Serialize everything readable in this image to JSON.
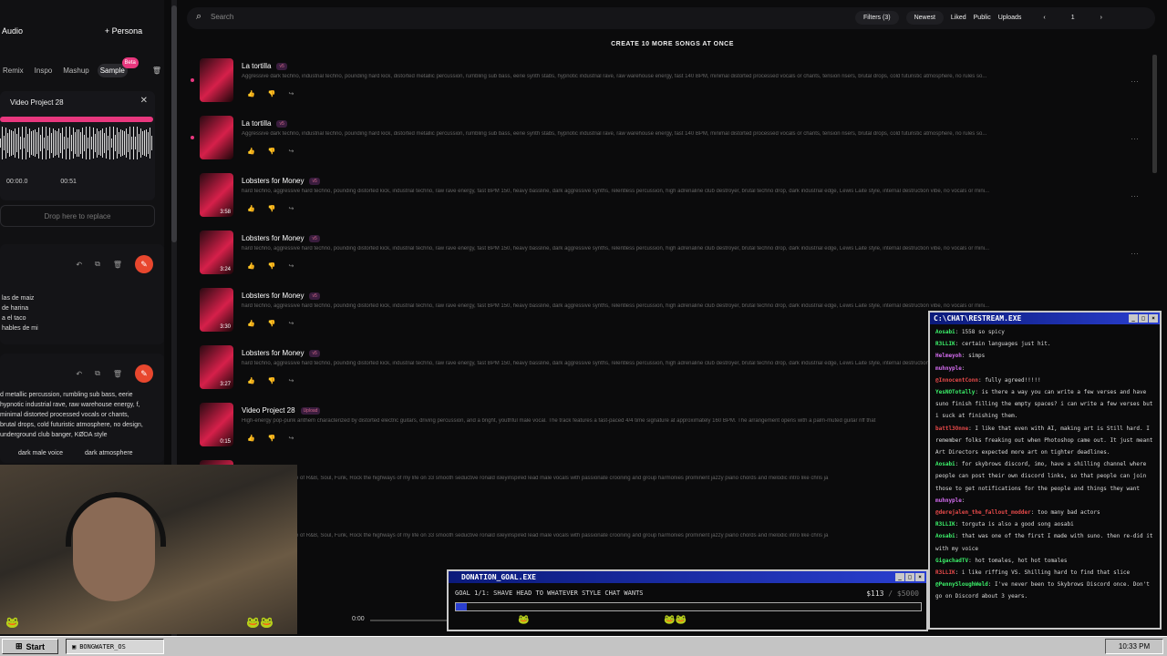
{
  "left": {
    "tab_audio": "Audio",
    "tab_persona": "+ Persona",
    "modes": [
      "Remix",
      "Inspo",
      "Mashup",
      "Sample"
    ],
    "beta": "Beta",
    "project_title": "Video Project 28",
    "time_start": "00:00.0",
    "time_end": "00:51",
    "drop": "Drop here to replace",
    "lyrics": [
      "las de maiz",
      "de harina",
      "a el taco",
      "hables de mi"
    ],
    "style_text": "d metallic percussion, rumbling sub bass, eerie hypnotic industrial rave, raw warehouse energy, f, minimal distorted processed vocals or chants, brutal drops, cold futuristic atmosphere, no design, underground club banger, KØDA style",
    "tags": [
      "dark male voice",
      "dark atmosphere"
    ]
  },
  "top": {
    "search_placeholder": "Search",
    "filters": "Filters (3)",
    "sort": "Newest",
    "liked": "Liked",
    "public": "Public",
    "uploads": "Uploads",
    "page": "1"
  },
  "create": "CREATE 10 MORE SONGS AT ONCE",
  "songs": [
    {
      "title": "La tortilla",
      "badge": "v5",
      "dur": "",
      "desc": "Aggressive dark techno, industrial techno, pounding hard kick, distorted metallic percussion, rumbling sub bass, eerie synth stabs, hypnotic industrial rave, raw warehouse energy, fast 140 BPM, minimal distorted processed vocals or chants, tension risers, brutal drops, cold futuristic atmosphere, no rules so..."
    },
    {
      "title": "La tortilla",
      "badge": "v5",
      "dur": "",
      "desc": "Aggressive dark techno, industrial techno, pounding hard kick, distorted metallic percussion, rumbling sub bass, eerie synth stabs, hypnotic industrial rave, raw warehouse energy, fast 140 BPM, minimal distorted processed vocals or chants, tension risers, brutal drops, cold futuristic atmosphere, no rules so..."
    },
    {
      "title": "Lobsters for Money",
      "badge": "v5",
      "dur": "3:58",
      "desc": "hard techno, aggressive hard techno, pounding distorted kick, industrial techno, raw rave energy, fast BPM 150, heavy bassline, dark aggressive synths, relentless percussion, high adrenaline club destroyer, brutal techno drop, dark industrial edge, Lewis Laite style, internal destruction vibe, no vocals or mini..."
    },
    {
      "title": "Lobsters for Money",
      "badge": "v5",
      "dur": "3:24",
      "desc": "hard techno, aggressive hard techno, pounding distorted kick, industrial techno, raw rave energy, fast BPM 150, heavy bassline, dark aggressive synths, relentless percussion, high adrenaline club destroyer, brutal techno drop, dark industrial edge, Lewis Laite style, internal destruction vibe, no vocals or mini..."
    },
    {
      "title": "Lobsters for Money",
      "badge": "v5",
      "dur": "3:30",
      "desc": "hard techno, aggressive hard techno, pounding distorted kick, industrial techno, raw rave energy, fast BPM 150, heavy bassline, dark aggressive synths, relentless percussion, high adrenaline club destroyer, brutal techno drop, dark industrial edge, Lewis Laite style, internal destruction vibe, no vocals or mini..."
    },
    {
      "title": "Lobsters for Money",
      "badge": "v5",
      "dur": "3:27",
      "desc": "hard techno, aggressive hard techno, pounding distorted kick, industrial techno, raw rave energy, fast BPM 150, heavy bassline, dark aggressive synths, relentless percussion, high adrenaline club destroyer, brutal techno drop, dark industrial edge, Lewis Laite style, internal destruction vibe, no vocals or mini..."
    },
    {
      "title": "Video Project 28",
      "badge": "Upload",
      "dur": "0:15",
      "desc": "High-energy pop-punk anthem characterized by distorted electric guitars, driving percussion, and a bright, youthful male vocal. The track features a fast-paced 4/4 time signature at approximately 160 BPM. The arrangement opens with a palm-muted guitar riff that"
    },
    {
      "title": "",
      "badge": "v5",
      "dur": "",
      "desc": "ballad in the exact style of R&B, Soul, Funk, Rock the highways of my life on 33 smooth seductive ronald isleyinspired lead male vocals with passionate crooning and group harmonies prominent jazzy piano chords and melodic intro like chris ja"
    },
    {
      "title": "",
      "badge": "v5",
      "dur": "",
      "desc": "ballad in the exact style of R&B, Soul, Funk, Rock the highways of my life on 33 smooth seductive ronald isleyinspired lead male vocals with passionate crooning and group harmonies prominent jazzy piano chords and melodic intro like chris ja"
    }
  ],
  "chat": {
    "title": "C:\\CHAT\\RESTREAM.EXE",
    "messages": [
      {
        "user": "Aosabi",
        "color": "#3cf06a",
        "text": "1558 so spicy"
      },
      {
        "user": "R3LLIK",
        "color": "#3cf06a",
        "text": "certain languages just hit."
      },
      {
        "user": "Helmeyoh",
        "color": "#d46cf0",
        "text": "simps"
      },
      {
        "user": "muhnyple",
        "color": "#d46cf0",
        "text": ""
      },
      {
        "user": "@InnocentConn",
        "color": "#e84a4a",
        "text": "fully agreed!!!!!"
      },
      {
        "user": "YesNOTotally",
        "color": "#3cf06a",
        "text": "is there a way you can write a few verses and have suno finish filling the empty spaces? i can write a few verses but i suck at finishing them."
      },
      {
        "user": "battl3Onne",
        "color": "#e84a4a",
        "text": "I like that even with AI, making art is Still hard. I remember folks freaking out when Photoshop came out. It just meant Art Directors expected more art on tighter deadlines."
      },
      {
        "user": "Aosabi",
        "color": "#3cf06a",
        "text": "for skybrows discord, imo, have a shilling channel where people can post their own discord links, so that people can join those to get notifications for the people and things they want"
      },
      {
        "user": "muhnyple",
        "color": "#d46cf0",
        "text": ""
      },
      {
        "user": "@derejalen_the_fallout_modder",
        "color": "#e84a4a",
        "text": "too many bad actors"
      },
      {
        "user": "R3LLIK",
        "color": "#3cf06a",
        "text": "torguta is also a good song aosabi"
      },
      {
        "user": "Aosabi",
        "color": "#3cf06a",
        "text": "that was one of the first I made with suno. then re-did it with my voice"
      },
      {
        "user": "GigachadTV",
        "color": "#3cf06a",
        "text": "hot tomales, hot hot tomales"
      },
      {
        "user": "R3LLIK",
        "color": "#e84a4a",
        "text": "i like riffing VS. Shilling hard to find that slice"
      },
      {
        "user": "@PennySloughWeld",
        "color": "#3cf06a",
        "text": "I've never been to Skybrows Discord once. Don't go on Discord about 3 years."
      }
    ]
  },
  "donation": {
    "title": "DONATION_GOAL.EXE",
    "goal": "GOAL 1/1: SHAVE HEAD TO WHATEVER STYLE CHAT WANTS",
    "amount": "$113",
    "total": "/ $5000",
    "progress": 0.0226
  },
  "player": {
    "time": "0:00"
  },
  "taskbar": {
    "start": "Start",
    "item": "BONGWATER_OS",
    "clock": "10:33 PM"
  }
}
